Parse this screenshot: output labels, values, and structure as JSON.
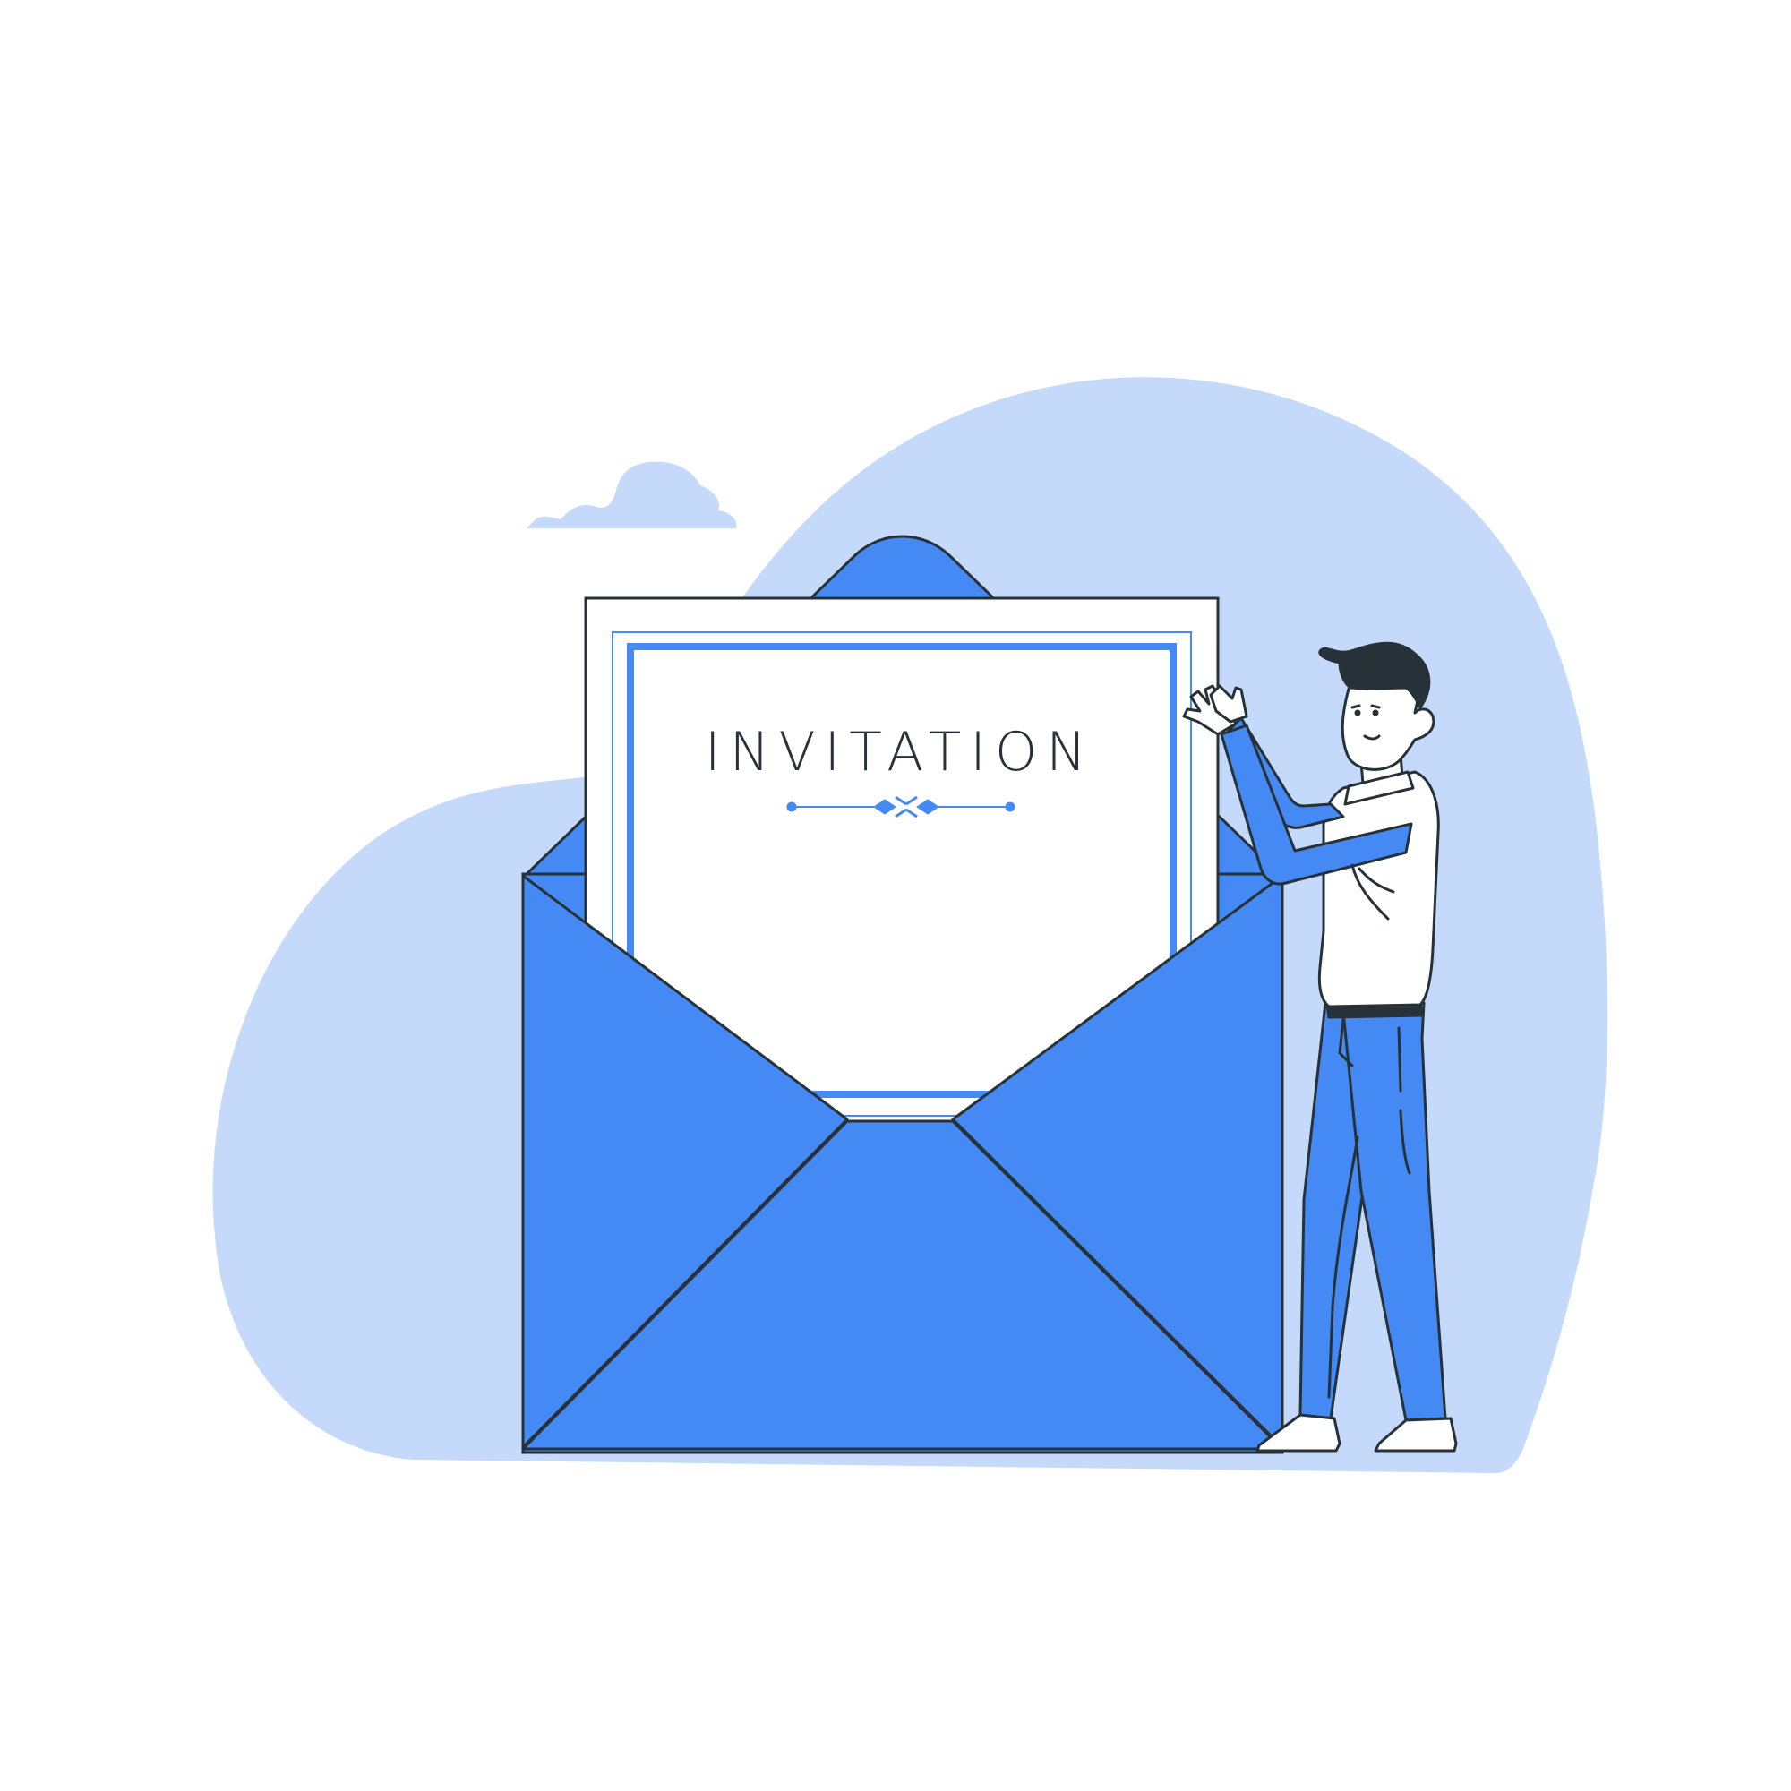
{
  "card": {
    "title": "INVITATION"
  },
  "colors": {
    "background": "#ffffff",
    "blob": "#c5dafa",
    "accent": "#4589f4",
    "outline": "#263238",
    "paper": "#ffffff",
    "hair": "#263238"
  },
  "icons": {
    "flourish": "ornamental-divider",
    "cloud_left": "cloud",
    "cloud_right": "cloud"
  }
}
